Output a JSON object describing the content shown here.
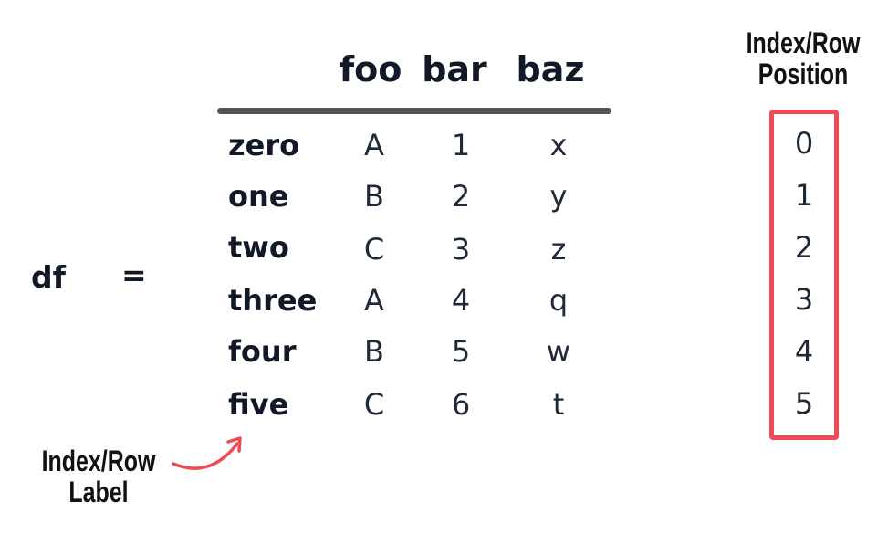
{
  "df_label": "df",
  "equals": "=",
  "columns": [
    "foo",
    "bar",
    "baz"
  ],
  "rows": [
    {
      "label": "zero",
      "values": [
        "A",
        "1",
        "x"
      ]
    },
    {
      "label": "one",
      "values": [
        "B",
        "2",
        "y"
      ]
    },
    {
      "label": "two",
      "values": [
        "C",
        "3",
        "z"
      ]
    },
    {
      "label": "three",
      "values": [
        "A",
        "4",
        "q"
      ]
    },
    {
      "label": "four",
      "values": [
        "B",
        "5",
        "w"
      ]
    },
    {
      "label": "five",
      "values": [
        "C",
        "6",
        "t"
      ]
    }
  ],
  "positions": [
    "0",
    "1",
    "2",
    "3",
    "4",
    "5"
  ],
  "position_caption": {
    "line1": "Index/Row",
    "line2": "Position"
  },
  "label_caption": {
    "line1": "Index/Row",
    "line2": "Label"
  },
  "colors": {
    "highlight": "#ef4a55",
    "header_rule": "#555555",
    "text": "#111827"
  }
}
